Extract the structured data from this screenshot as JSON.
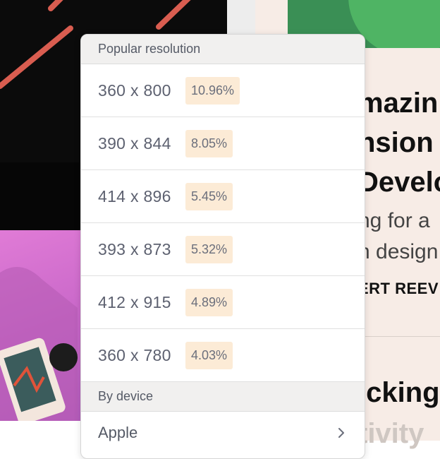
{
  "dropdown": {
    "popular_header": "Popular resolution",
    "resolutions": [
      {
        "label": "360 x 800",
        "share": "10.96%"
      },
      {
        "label": "390 x 844",
        "share": "8.05%"
      },
      {
        "label": "414 x 896",
        "share": "5.45%"
      },
      {
        "label": "393 x 873",
        "share": "5.32%"
      },
      {
        "label": "412 x 915",
        "share": "4.89%"
      },
      {
        "label": "360 x 780",
        "share": "4.03%"
      }
    ],
    "device_header": "By device",
    "devices": [
      {
        "label": "Apple",
        "icon": "chevron-right-icon"
      }
    ]
  },
  "background_article": {
    "line1": "mazin",
    "line2": "nsion",
    "line3": "Develo",
    "line4": "ng for a",
    "line5": "n design",
    "line6": "ERT REEV",
    "line7": "icking",
    "line8": "tivity"
  },
  "colors": {
    "badge_bg": "#fcebd6",
    "header_bg": "#f1f0ef",
    "accent_green": "#3a8f55",
    "stripe": "#e05a5a"
  }
}
